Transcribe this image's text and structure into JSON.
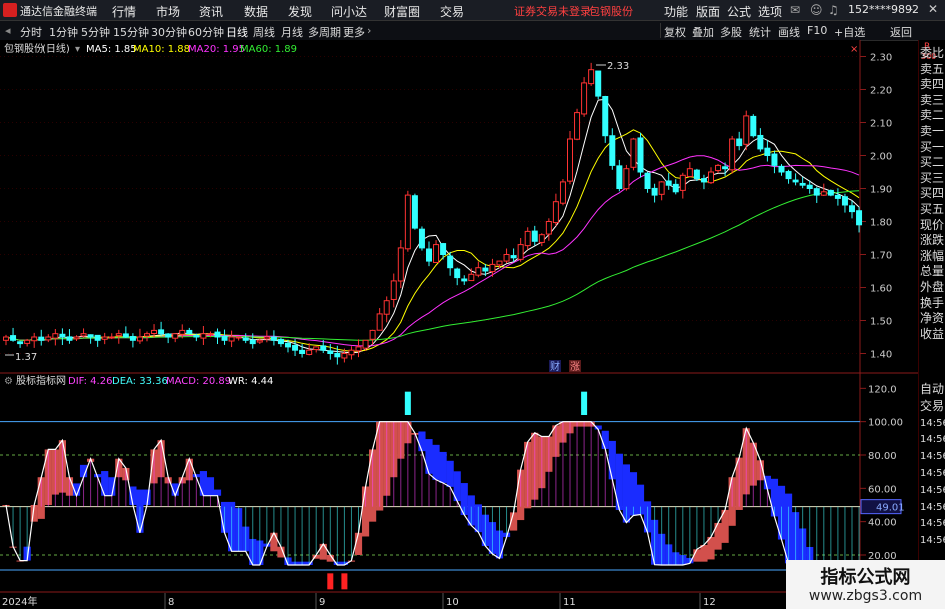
{
  "app": {
    "title": "通达信金融终端",
    "broker_notice": "证券交易未登录",
    "stock_link": "包钢股份",
    "account": "152****9892"
  },
  "menu": [
    "行情",
    "市场",
    "资讯",
    "数据",
    "发现",
    "问小达",
    "财富圈",
    "交易"
  ],
  "menu_right": [
    "功能",
    "版面",
    "公式",
    "选项"
  ],
  "periods": [
    "分时",
    "1分钟",
    "5分钟",
    "15分钟",
    "30分钟",
    "60分钟",
    "日线",
    "周线",
    "月线",
    "多周期",
    "更多"
  ],
  "active_period": "日线",
  "right_buttons": [
    "复权",
    "叠加",
    "多股",
    "统计",
    "画线",
    "F10",
    "+自选",
    "返回"
  ],
  "stock": {
    "name": "包钢股份",
    "period": "(日线)"
  },
  "ma": [
    {
      "label": "MA5: 1.85",
      "color": "#ffffff"
    },
    {
      "label": "MA10: 1.88",
      "color": "#ffff00"
    },
    {
      "label": "MA20: 1.95",
      "color": "#ff33ff"
    },
    {
      "label": "MA60: 1.89",
      "color": "#33ee33"
    }
  ],
  "price_axis": {
    "ticks": [
      2.3,
      2.2,
      2.1,
      2.0,
      1.9,
      1.8,
      1.7,
      1.6,
      1.5,
      1.4
    ],
    "min": 1.35,
    "max": 2.35
  },
  "price_markers": {
    "high": "2.33",
    "low": "1.37"
  },
  "markers": {
    "cai": "财",
    "zhang": "涨"
  },
  "indicator": {
    "title": "股标指标网",
    "dif": "DIF: 4.26",
    "dea": "DEA: 33.36",
    "macd": "MACD: 20.89",
    "wr": "WR: 4.44"
  },
  "indicator_axis": {
    "ticks": [
      120.0,
      100.0,
      80.0,
      60.0,
      40.0,
      20.0
    ],
    "min": 5,
    "max": 125,
    "current": "49.01"
  },
  "time_axis": [
    "2024年",
    "8",
    "9",
    "10",
    "11",
    "12"
  ],
  "sidebar": [
    "委比",
    "卖五",
    "卖四",
    "卖三",
    "卖二",
    "卖一",
    "买一",
    "买二",
    "买三",
    "买四",
    "买五",
    "现价",
    "涨跌",
    "涨幅",
    "总量",
    "外盘",
    "换手",
    "净资",
    "收益"
  ],
  "sidebar_bottom": [
    "自动",
    "交易",
    "14:56",
    "14:56",
    "14:56",
    "14:56",
    "14:56",
    "14:56",
    "14:56",
    "14:56"
  ],
  "sidebar_badge": {
    "r": "R",
    "code": "300"
  },
  "watermark": {
    "title": "指标公式网",
    "url": "www.zbgs3.com"
  },
  "colors": {
    "up": "#ff3333",
    "down": "#33ffff",
    "ma5": "#ffffff",
    "ma10": "#ffff00",
    "ma20": "#ff33ff",
    "ma60": "#33ee33",
    "hline": "#4aa8ff"
  },
  "chart_data": {
    "type": "candlestick",
    "ylim": [
      1.35,
      2.35
    ],
    "closes": [
      1.45,
      1.44,
      1.43,
      1.44,
      1.45,
      1.44,
      1.45,
      1.46,
      1.45,
      1.44,
      1.45,
      1.46,
      1.45,
      1.44,
      1.45,
      1.45,
      1.46,
      1.45,
      1.44,
      1.45,
      1.46,
      1.47,
      1.46,
      1.45,
      1.46,
      1.47,
      1.46,
      1.45,
      1.46,
      1.46,
      1.45,
      1.44,
      1.45,
      1.45,
      1.44,
      1.43,
      1.44,
      1.45,
      1.44,
      1.43,
      1.42,
      1.41,
      1.4,
      1.41,
      1.42,
      1.41,
      1.4,
      1.39,
      1.4,
      1.41,
      1.42,
      1.44,
      1.47,
      1.52,
      1.56,
      1.62,
      1.72,
      1.88,
      1.78,
      1.72,
      1.68,
      1.73,
      1.7,
      1.66,
      1.63,
      1.62,
      1.64,
      1.66,
      1.65,
      1.67,
      1.68,
      1.7,
      1.69,
      1.73,
      1.77,
      1.74,
      1.76,
      1.8,
      1.86,
      1.92,
      2.05,
      2.13,
      2.22,
      2.26,
      2.18,
      2.06,
      1.97,
      1.9,
      1.96,
      2.05,
      1.95,
      1.9,
      1.88,
      1.92,
      1.91,
      1.89,
      1.94,
      1.96,
      1.93,
      1.92,
      1.95,
      1.97,
      1.96,
      2.05,
      2.03,
      2.12,
      2.06,
      2.02,
      2.0,
      1.97,
      1.95,
      1.93,
      1.92,
      1.91,
      1.9,
      1.88,
      1.89,
      1.88,
      1.87,
      1.85,
      1.83,
      1.79
    ],
    "ma5": [],
    "ma10": [],
    "ma20": [],
    "ma60": []
  }
}
